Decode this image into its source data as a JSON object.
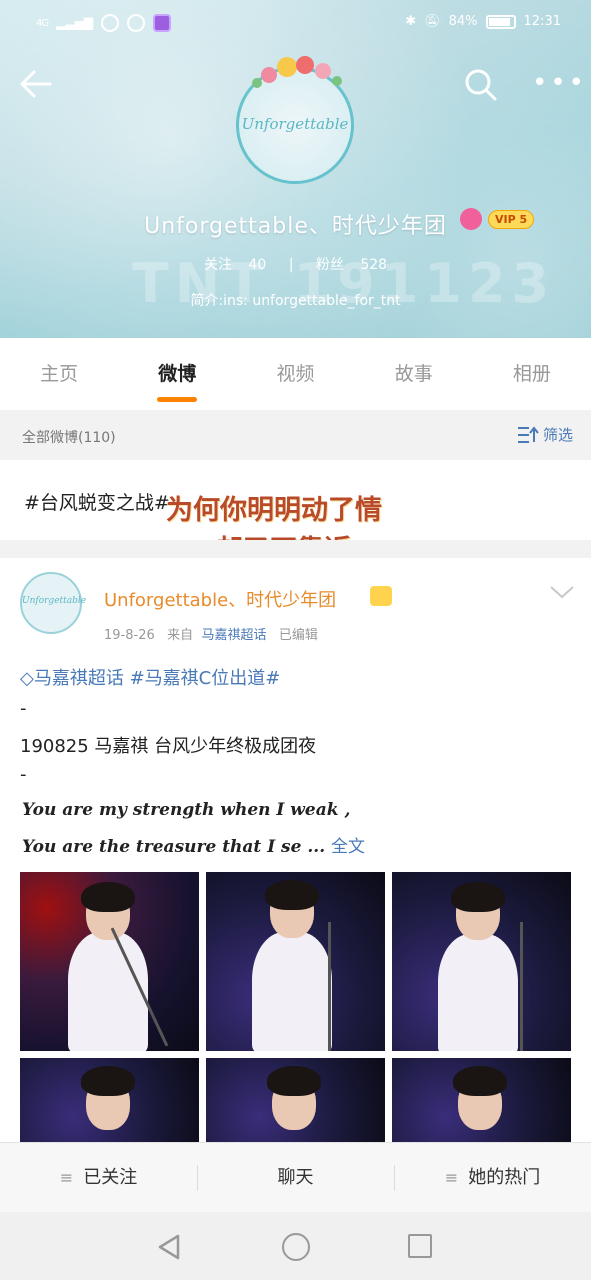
{
  "status_bar": {
    "signal": "4G",
    "battery_percent": "84%",
    "time": "12:31"
  },
  "profile": {
    "avatar_text": "Unforgettable",
    "username": "Unforgettable、时代少年团",
    "vip_label": "VIP 5",
    "follow_label": "关注",
    "follow_count": "40",
    "fans_label": "粉丝",
    "fans_count": "528",
    "intro": "简介:ins: unforgettable_for_tnt",
    "watermark": "TNT 191123"
  },
  "tabs": [
    {
      "label": "主页",
      "active": false
    },
    {
      "label": "微博",
      "active": true
    },
    {
      "label": "视频",
      "active": false
    },
    {
      "label": "故事",
      "active": false
    },
    {
      "label": "相册",
      "active": false
    }
  ],
  "filter": {
    "count_label": "全部微博(110)",
    "filter_label": "筛选"
  },
  "pinned": {
    "text": "#台风蜕变之战#",
    "overlay_line1": "为何你明明动了情",
    "overlay_line2": "却又不靠近"
  },
  "post": {
    "avatar_text": "Unforgettable",
    "author": "Unforgettable、时代少年团",
    "date": "19-8-26",
    "from_label": "来自",
    "source": "马嘉祺超话",
    "edited": "已编辑",
    "tags": "马嘉祺超话 #马嘉祺C位出道#",
    "dash1": "-",
    "line1": "190825 马嘉祺 台风少年终极成团夜",
    "dash2": "-",
    "en_line1": "You are my strength when I weak ,",
    "en_line2": "You are the treasure that I se ...",
    "full_text": "全文"
  },
  "actions": {
    "followed": "已关注",
    "chat": "聊天",
    "hot": "她的热门"
  },
  "colors": {
    "accent": "#ff8200",
    "link": "#4a79b8",
    "author": "#e98b2a"
  }
}
